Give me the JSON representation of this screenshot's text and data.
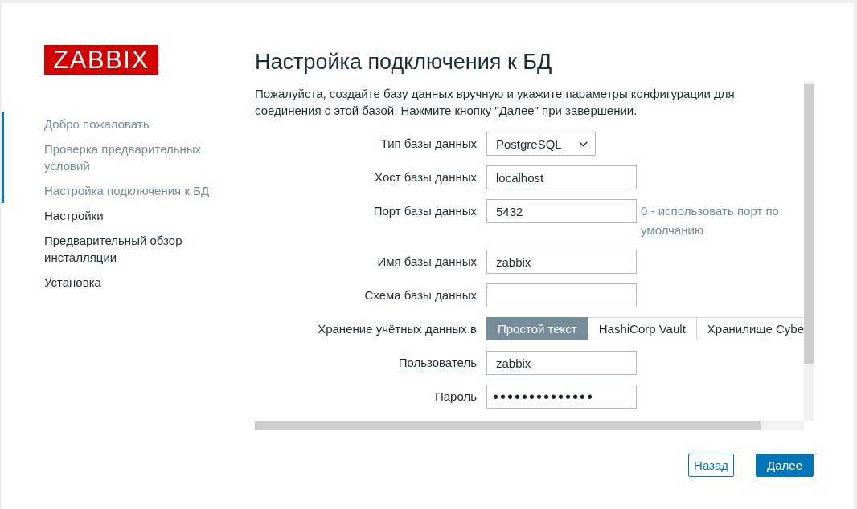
{
  "logo": {
    "text": "ZABBIX"
  },
  "steps": [
    {
      "label": "Добро пожаловать",
      "done": true
    },
    {
      "label": "Проверка предварительных условий",
      "done": true
    },
    {
      "label": "Настройка подключения к БД",
      "done": true
    },
    {
      "label": "Настройки",
      "done": false
    },
    {
      "label": "Предварительный обзор инсталляции",
      "done": false
    },
    {
      "label": "Установка",
      "done": false
    }
  ],
  "title": "Настройка подключения к БД",
  "intro": "Пожалуйста, создайте базу данных вручную и укажите параметры конфигурации для соединения с этой базой. Нажмите кнопку \"Далее\" при завершении.",
  "fields": [
    {
      "kind": "select",
      "label": "Тип базы данных",
      "value": "PostgreSQL"
    },
    {
      "kind": "text",
      "label": "Хост базы данных",
      "value": "localhost"
    },
    {
      "kind": "text",
      "label": "Порт базы данных",
      "value": "5432",
      "hint": "0 - использовать порт по умолчанию"
    },
    {
      "kind": "text",
      "label": "Имя базы данных",
      "value": "zabbix"
    },
    {
      "kind": "text",
      "label": "Схема базы данных"
    },
    {
      "kind": "segmented",
      "label": "Хранение учётных данных в",
      "options": [
        {
          "label": "Простой текст",
          "selected": true
        },
        {
          "label": "HashiCorp Vault",
          "selected": false
        },
        {
          "label": "Хранилище Cybe",
          "selected": false
        }
      ]
    },
    {
      "kind": "text",
      "label": "Пользователь",
      "value": "zabbix"
    },
    {
      "kind": "password",
      "label": "Пароль",
      "value": "••••••••••••••"
    }
  ],
  "buttons": [
    {
      "label": "Назад",
      "kind": "secondary"
    },
    {
      "label": "Далее",
      "kind": "primary"
    }
  ]
}
